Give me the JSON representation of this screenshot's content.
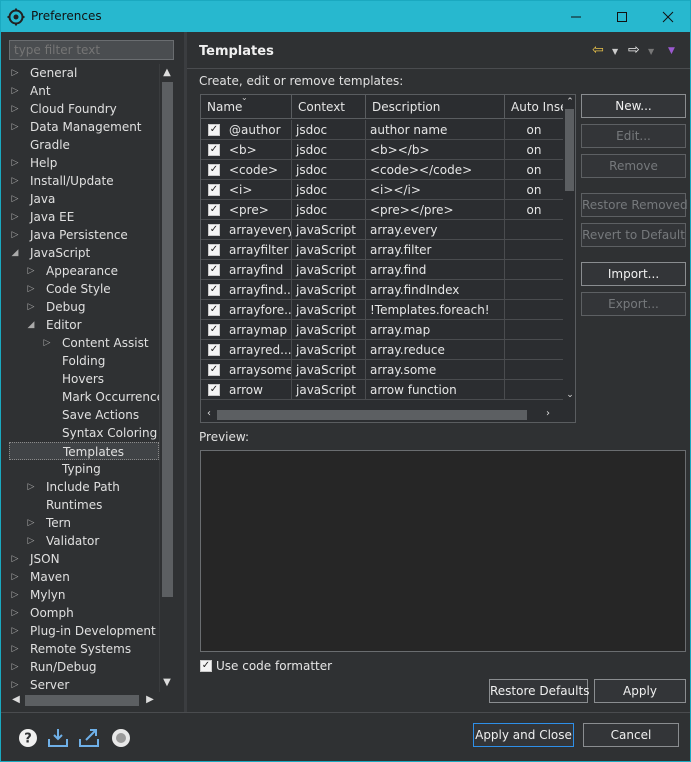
{
  "window": {
    "title": "Preferences"
  },
  "filter": {
    "placeholder": "type filter text"
  },
  "tree": [
    {
      "label": "General",
      "indent": 0,
      "arrow": "right"
    },
    {
      "label": "Ant",
      "indent": 0,
      "arrow": "right"
    },
    {
      "label": "Cloud Foundry",
      "indent": 0,
      "arrow": "right"
    },
    {
      "label": "Data Management",
      "indent": 0,
      "arrow": "right"
    },
    {
      "label": "Gradle",
      "indent": 0,
      "arrow": "none"
    },
    {
      "label": "Help",
      "indent": 0,
      "arrow": "right"
    },
    {
      "label": "Install/Update",
      "indent": 0,
      "arrow": "right"
    },
    {
      "label": "Java",
      "indent": 0,
      "arrow": "right"
    },
    {
      "label": "Java EE",
      "indent": 0,
      "arrow": "right"
    },
    {
      "label": "Java Persistence",
      "indent": 0,
      "arrow": "right"
    },
    {
      "label": "JavaScript",
      "indent": 0,
      "arrow": "down"
    },
    {
      "label": "Appearance",
      "indent": 1,
      "arrow": "right"
    },
    {
      "label": "Code Style",
      "indent": 1,
      "arrow": "right"
    },
    {
      "label": "Debug",
      "indent": 1,
      "arrow": "right"
    },
    {
      "label": "Editor",
      "indent": 1,
      "arrow": "down"
    },
    {
      "label": "Content Assist",
      "indent": 2,
      "arrow": "right"
    },
    {
      "label": "Folding",
      "indent": 2,
      "arrow": "none"
    },
    {
      "label": "Hovers",
      "indent": 2,
      "arrow": "none"
    },
    {
      "label": "Mark Occurrences",
      "indent": 2,
      "arrow": "none"
    },
    {
      "label": "Save Actions",
      "indent": 2,
      "arrow": "none"
    },
    {
      "label": "Syntax Coloring",
      "indent": 2,
      "arrow": "none"
    },
    {
      "label": "Templates",
      "indent": 2,
      "arrow": "none",
      "selected": true
    },
    {
      "label": "Typing",
      "indent": 2,
      "arrow": "none"
    },
    {
      "label": "Include Path",
      "indent": 1,
      "arrow": "right"
    },
    {
      "label": "Runtimes",
      "indent": 1,
      "arrow": "none"
    },
    {
      "label": "Tern",
      "indent": 1,
      "arrow": "right"
    },
    {
      "label": "Validator",
      "indent": 1,
      "arrow": "right"
    },
    {
      "label": "JSON",
      "indent": 0,
      "arrow": "right"
    },
    {
      "label": "Maven",
      "indent": 0,
      "arrow": "right"
    },
    {
      "label": "Mylyn",
      "indent": 0,
      "arrow": "right"
    },
    {
      "label": "Oomph",
      "indent": 0,
      "arrow": "right"
    },
    {
      "label": "Plug-in Development",
      "indent": 0,
      "arrow": "right"
    },
    {
      "label": "Remote Systems",
      "indent": 0,
      "arrow": "right"
    },
    {
      "label": "Run/Debug",
      "indent": 0,
      "arrow": "right"
    },
    {
      "label": "Server",
      "indent": 0,
      "arrow": "right"
    }
  ],
  "page": {
    "title": "Templates",
    "description": "Create, edit or remove templates:",
    "preview_label": "Preview:",
    "use_formatter_label": "Use code formatter",
    "use_formatter_checked": true
  },
  "table": {
    "columns": [
      "Name",
      "Context",
      "Description",
      "Auto Insert"
    ],
    "rows": [
      {
        "checked": true,
        "name": "@author",
        "context": "jsdoc",
        "description": "author name",
        "auto": "on"
      },
      {
        "checked": true,
        "name": "<b>",
        "context": "jsdoc",
        "description": "<b></b>",
        "auto": "on"
      },
      {
        "checked": true,
        "name": "<code>",
        "context": "jsdoc",
        "description": "<code></code>",
        "auto": "on"
      },
      {
        "checked": true,
        "name": "<i>",
        "context": "jsdoc",
        "description": "<i></i>",
        "auto": "on"
      },
      {
        "checked": true,
        "name": "<pre>",
        "context": "jsdoc",
        "description": "<pre></pre>",
        "auto": "on"
      },
      {
        "checked": true,
        "name": "arrayevery",
        "context": "javaScript",
        "description": "array.every",
        "auto": ""
      },
      {
        "checked": true,
        "name": "arrayfilter",
        "context": "javaScript",
        "description": "array.filter",
        "auto": ""
      },
      {
        "checked": true,
        "name": "arrayfind",
        "context": "javaScript",
        "description": "array.find",
        "auto": ""
      },
      {
        "checked": true,
        "name": "arrayfind...",
        "context": "javaScript",
        "description": "array.findIndex",
        "auto": ""
      },
      {
        "checked": true,
        "name": "arrayfore...",
        "context": "javaScript",
        "description": "!Templates.foreach!",
        "auto": ""
      },
      {
        "checked": true,
        "name": "arraymap",
        "context": "javaScript",
        "description": "array.map",
        "auto": ""
      },
      {
        "checked": true,
        "name": "arrayred...",
        "context": "javaScript",
        "description": "array.reduce",
        "auto": ""
      },
      {
        "checked": true,
        "name": "arraysome",
        "context": "javaScript",
        "description": "array.some",
        "auto": ""
      },
      {
        "checked": true,
        "name": "arrow",
        "context": "javaScript",
        "description": "arrow function",
        "auto": ""
      }
    ]
  },
  "side_buttons": {
    "new": "New...",
    "edit": "Edit...",
    "remove": "Remove",
    "restore_removed": "Restore Removed",
    "revert_default": "Revert to Default",
    "import": "Import...",
    "export": "Export..."
  },
  "page_buttons": {
    "restore_defaults": "Restore Defaults",
    "apply": "Apply"
  },
  "dialog_buttons": {
    "apply_close": "Apply and Close",
    "cancel": "Cancel"
  },
  "colors": {
    "titlebar": "#27b8cf",
    "background": "#2f3133",
    "nav_arrow": "#e8c14a",
    "focus_border": "#2e8fe8"
  }
}
